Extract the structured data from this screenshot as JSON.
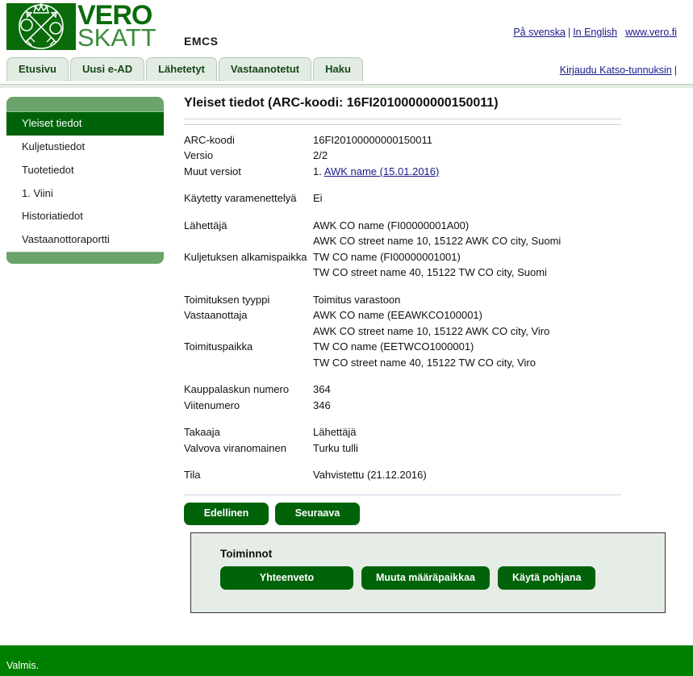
{
  "header": {
    "logo": {
      "wordmark_top": "VERO",
      "wordmark_bottom": "SKATT",
      "emblem_icon": "finnish-coat-of-arms-icon"
    },
    "app_title": "EMCS",
    "links": {
      "swedish": "På svenska",
      "english": "In English",
      "website": "www.vero.fi",
      "separator": "|"
    },
    "login": {
      "label": "Kirjaudu Katso-tunnuksin",
      "separator": "|"
    }
  },
  "tabs": [
    {
      "label": "Etusivu"
    },
    {
      "label": "Uusi e-AD"
    },
    {
      "label": "Lähetetyt"
    },
    {
      "label": "Vastaanotetut"
    },
    {
      "label": "Haku"
    }
  ],
  "sidebar": {
    "items": [
      {
        "label": "Yleiset tiedot",
        "active": true
      },
      {
        "label": "Kuljetustiedot",
        "active": false
      },
      {
        "label": "Tuotetiedot",
        "active": false
      },
      {
        "label": "1. Viini",
        "active": false
      },
      {
        "label": "Historiatiedot",
        "active": false
      },
      {
        "label": "Vastaanottoraportti",
        "active": false
      }
    ]
  },
  "main": {
    "title": "Yleiset tiedot (ARC-koodi: 16FI20100000000150011)",
    "fields": {
      "arc_label": "ARC-koodi",
      "arc_value": "16FI20100000000150011",
      "versio_label": "Versio",
      "versio_value": "2/2",
      "muut_versiot_label": "Muut versiot",
      "muut_versiot_prefix": "1. ",
      "muut_versiot_link": "AWK name (15.01.2016)",
      "varamenettely_label": "Käytetty varamenettelyä",
      "varamenettely_value": "Ei",
      "lahettaja_label": "Lähettäjä",
      "lahettaja_value_1": "AWK CO name (FI00000001A00)",
      "lahettaja_value_2": "AWK CO street name 10, 15122 AWK CO city, Suomi",
      "alkamispaikka_label": "Kuljetuksen alkamispaikka",
      "alkamispaikka_value_1": "TW CO name (FI00000001001)",
      "alkamispaikka_value_2": "TW CO street name 40, 15122 TW CO city, Suomi",
      "toimitustyyppi_label": "Toimituksen tyyppi",
      "toimitustyyppi_value": "Toimitus varastoon",
      "vastaanottaja_label": "Vastaanottaja",
      "vastaanottaja_value_1": "AWK CO name (EEAWKCO100001)",
      "vastaanottaja_value_2": "AWK CO street name 10, 15122 AWK CO city, Viro",
      "toimituspaikka_label": "Toimituspaikka",
      "toimituspaikka_value_1": "TW CO name (EETWCO1000001)",
      "toimituspaikka_value_2": "TW CO street name 40, 15122 TW CO city, Viro",
      "kauppalasku_label": "Kauppalaskun numero",
      "kauppalasku_value": "364",
      "viitenumero_label": "Viitenumero",
      "viitenumero_value": "346",
      "takaaja_label": "Takaaja",
      "takaaja_value": "Lähettäjä",
      "viranomainen_label": "Valvova viranomainen",
      "viranomainen_value": "Turku tulli",
      "tila_label": "Tila",
      "tila_value": "Vahvistettu (21.12.2016)"
    },
    "nav_buttons": {
      "previous": "Edellinen",
      "next": "Seuraava"
    },
    "actions": {
      "title": "Toiminnot",
      "summary": "Yhteenveto",
      "change_destination": "Muuta määräpaikkaa",
      "use_as_template": "Käytä pohjana"
    }
  },
  "statusbar": {
    "text": "Valmis."
  },
  "colors": {
    "brand_green": "#0a6b0a",
    "dark_green": "#00630a",
    "status_green": "#008000",
    "sidebar_green": "#6aa46a",
    "tab_bg": "#e3ece3",
    "panel_bg": "#e6ece6",
    "link_blue": "#1a1a8c",
    "rule_gray": "#c9d6e2"
  }
}
